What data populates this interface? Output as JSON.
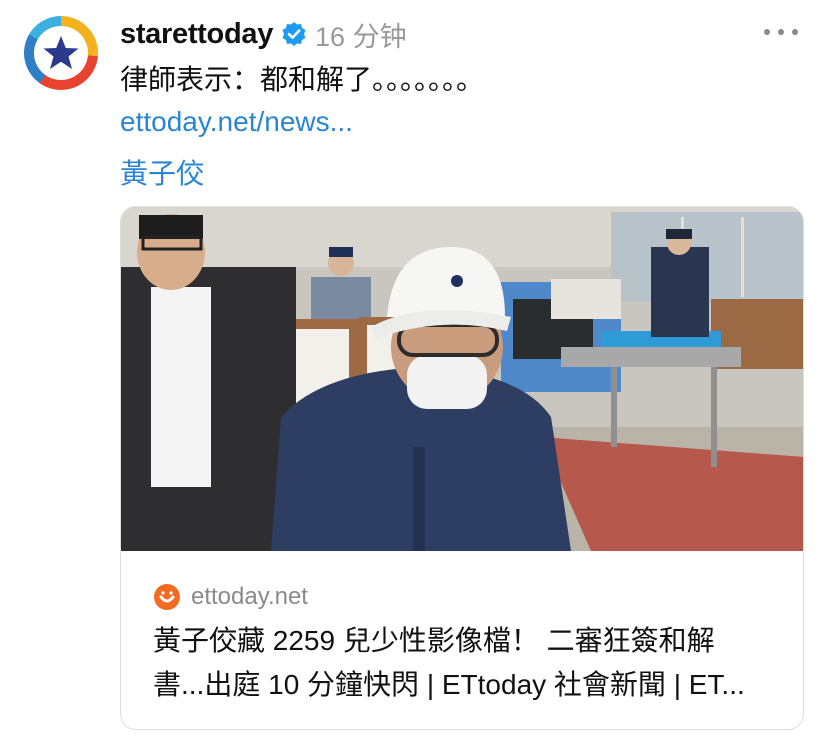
{
  "post": {
    "username": "starettoday",
    "timestamp": "16 分钟",
    "text": "律師表示：都和解了。。。。。。。",
    "link_text": "ettoday.net/news...",
    "tag": "黃子佼"
  },
  "card": {
    "source_domain": "ettoday.net",
    "title_line1": "黃子佼藏 2259 兒少性影像檔！ 二審狂簽和解",
    "title_line2": "書...出庭 10 分鐘快閃 | ETtoday 社會新聞 | ET..."
  },
  "icons": {
    "avatar": "star-logo-avatar",
    "verified": "verified-badge-icon",
    "more": "more-options-icon",
    "favicon": "ettoday-favicon-icon"
  },
  "colors": {
    "link": "#2a86d4",
    "verified": "#1d9bf0",
    "timestamp": "#999999",
    "favicon": "#f26b21",
    "avatar_star": "#2b3a8f"
  }
}
